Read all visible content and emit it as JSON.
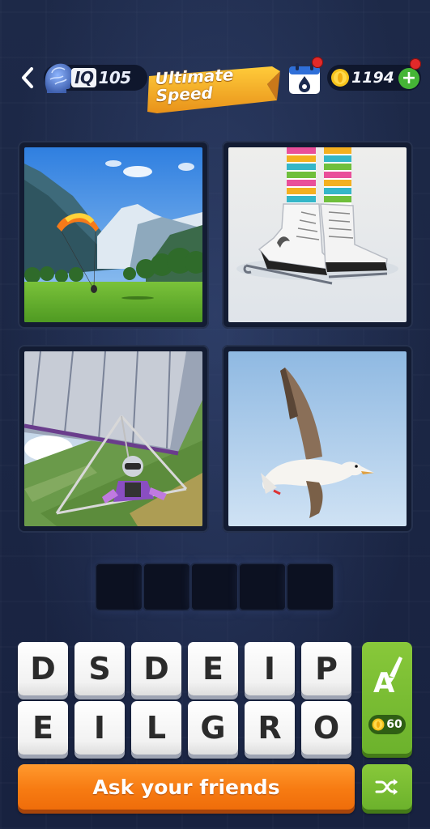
{
  "header": {
    "back_icon": "chevron-left-icon",
    "iq": {
      "label": "IQ",
      "value": "105",
      "icon": "brain-head-icon"
    },
    "event_banner": {
      "line1": "Ultimate",
      "line2": "Speed"
    },
    "daily_calendar": {
      "icon": "calendar-drop-icon",
      "badge": "notification-dot"
    },
    "coins": {
      "value": "1194",
      "icon": "coin-icon",
      "add_icon": "plus-icon",
      "add_label": "+"
    }
  },
  "pictures": [
    {
      "name": "paraglider",
      "description_icon": "paraglider-photo"
    },
    {
      "name": "ice-skates",
      "description_icon": "ice-skates-photo"
    },
    {
      "name": "hang-glider",
      "description_icon": "hang-glider-photo"
    },
    {
      "name": "seagull",
      "description_icon": "seagull-photo"
    }
  ],
  "answer": {
    "slot_count": 5
  },
  "letters": {
    "row1": [
      "D",
      "S",
      "D",
      "E",
      "I",
      "P"
    ],
    "row2": [
      "E",
      "I",
      "L",
      "G",
      "R",
      "O"
    ]
  },
  "hint": {
    "icon": "letter-a-brush-icon",
    "label": "A",
    "cost": "60"
  },
  "ask_friends": {
    "label": "Ask your friends"
  },
  "shuffle": {
    "icon": "shuffle-icon"
  },
  "colors": {
    "background": "#1b2644",
    "tile": "#ffffff",
    "green_button": "#6cb22c",
    "orange_button": "#f77b12",
    "gold_banner": "#f2a823",
    "coin": "#f5c21a"
  }
}
